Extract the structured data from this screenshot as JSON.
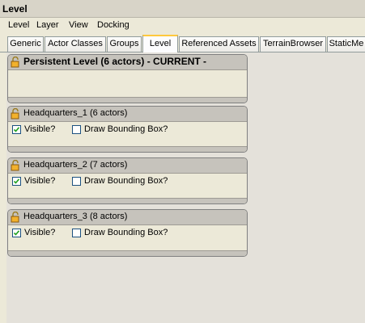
{
  "window": {
    "title": "Level"
  },
  "menu": [
    "Level",
    "Layer",
    "View",
    "Docking"
  ],
  "tabs": [
    {
      "label": "Generic"
    },
    {
      "label": "Actor Classes"
    },
    {
      "label": "Groups"
    },
    {
      "label": "Level",
      "active": true
    },
    {
      "label": "Referenced Assets"
    },
    {
      "label": "TerrainBrowser"
    },
    {
      "label": "StaticMe"
    }
  ],
  "levels": [
    {
      "name": "Persistent Level (6 actors)  - CURRENT -",
      "current": true
    },
    {
      "name": "Headquarters_1 (6 actors)",
      "visible": true,
      "visible_label": "Visible?",
      "bbox_label": "Draw Bounding Box?",
      "draw_bbox": false
    },
    {
      "name": "Headquarters_2 (7 actors)",
      "visible": true,
      "visible_label": "Visible?",
      "bbox_label": "Draw Bounding Box?",
      "draw_bbox": false
    },
    {
      "name": "Headquarters_3 (8 actors)",
      "visible": true,
      "visible_label": "Visible?",
      "bbox_label": "Draw Bounding Box?",
      "draw_bbox": false
    }
  ]
}
